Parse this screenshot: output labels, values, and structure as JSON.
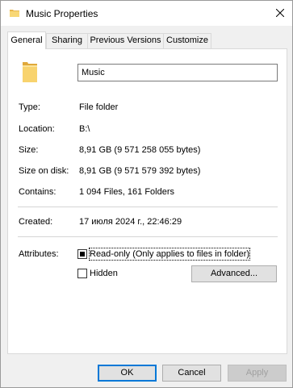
{
  "window": {
    "title": "Music Properties"
  },
  "tabs": [
    {
      "label": "General",
      "active": true
    },
    {
      "label": "Sharing",
      "active": false
    },
    {
      "label": "Previous Versions",
      "active": false
    },
    {
      "label": "Customize",
      "active": false
    }
  ],
  "general": {
    "name": "Music",
    "type_label": "Type:",
    "type_value": "File folder",
    "location_label": "Location:",
    "location_value": "B:\\",
    "size_label": "Size:",
    "size_value": "8,91 GB (9 571 258 055 bytes)",
    "size_on_disk_label": "Size on disk:",
    "size_on_disk_value": "8,91 GB (9 571 579 392 bytes)",
    "contains_label": "Contains:",
    "contains_value": "1 094 Files, 161 Folders",
    "created_label": "Created:",
    "created_value": "17 июля 2024 г., 22:46:29",
    "attributes_label": "Attributes:",
    "readonly_label": "Read-only (Only applies to files in folder)",
    "readonly_state": "indeterminate",
    "hidden_label": "Hidden",
    "hidden_checked": false,
    "advanced_label": "Advanced..."
  },
  "buttons": {
    "ok": "OK",
    "cancel": "Cancel",
    "apply": "Apply"
  },
  "icons": {
    "folder": "folder-icon",
    "close": "close-icon"
  },
  "colors": {
    "accent": "#0078d7",
    "folder": "#f4c460"
  }
}
